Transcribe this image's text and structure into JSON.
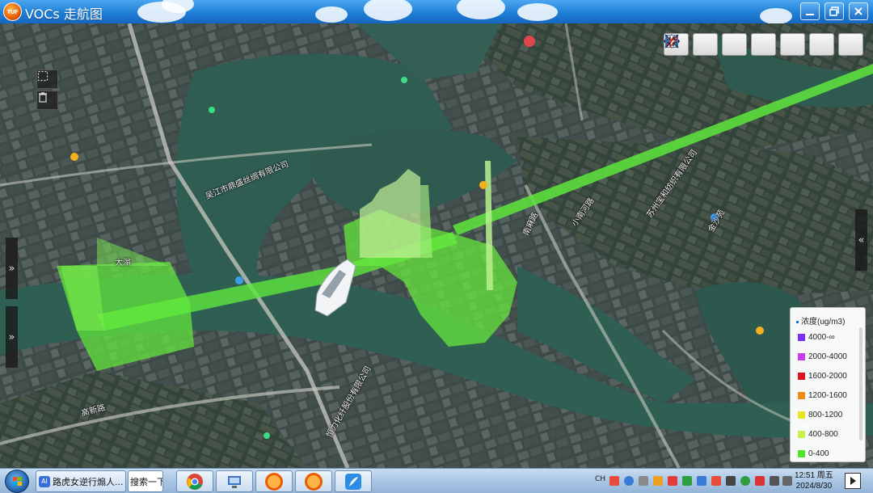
{
  "window": {
    "title": "VOCs 走航图",
    "logo_text": "TUF"
  },
  "map": {
    "labels": [
      {
        "name": "company-label-1",
        "text": "吴江市鼎盛丝绸有限公司"
      },
      {
        "name": "company-label-2",
        "text": "恒力化纤股份有限公司"
      },
      {
        "name": "company-label-3",
        "text": "苏州宝和纺织有限公司"
      },
      {
        "name": "road-label-1",
        "text": "小南河路"
      },
      {
        "name": "water-label-1",
        "text": "大滃"
      },
      {
        "name": "place-label-1",
        "text": "金沙苑"
      },
      {
        "name": "road-label-2",
        "text": "南麻路"
      },
      {
        "name": "road-label-3",
        "text": "高新路"
      }
    ],
    "trace_color": "#5ee63c",
    "vehicle": "survey-van"
  },
  "toolbar": {
    "tools": [
      {
        "name": "settings-tool",
        "icon": "gear-icon"
      },
      {
        "name": "chart-tool",
        "icon": "bar-chart-icon"
      },
      {
        "name": "palette-tool",
        "icon": "palette-icon"
      },
      {
        "name": "view-tool",
        "icon": "eye-icon"
      },
      {
        "name": "save-tool",
        "icon": "floppy-disk-icon"
      },
      {
        "name": "clear-tool",
        "icon": "eraser-icon"
      },
      {
        "name": "fullscreen-tool",
        "icon": "collapse-arrows-icon"
      }
    ]
  },
  "side_handles": {
    "left_label": "»",
    "right_label": "«"
  },
  "legend": {
    "title": "浓度(ug/m3)",
    "items": [
      {
        "label": "4000-∞",
        "color": "#7b2ff7"
      },
      {
        "label": "2000-4000",
        "color": "#c83cf0"
      },
      {
        "label": "1600-2000",
        "color": "#e0141e"
      },
      {
        "label": "1200-1600",
        "color": "#f08c14"
      },
      {
        "label": "800-1200",
        "color": "#e6e61e"
      },
      {
        "label": "400-800",
        "color": "#c8f04b"
      },
      {
        "label": "0-400",
        "color": "#50e628"
      }
    ]
  },
  "taskbar": {
    "items": [
      {
        "label": "路虎女逆行煽人...",
        "badge": "AI"
      },
      {
        "label": "搜索一下"
      }
    ],
    "tray_ime": "CH",
    "clock": {
      "time": "12:51 周五",
      "date": "2024/8/30"
    }
  }
}
